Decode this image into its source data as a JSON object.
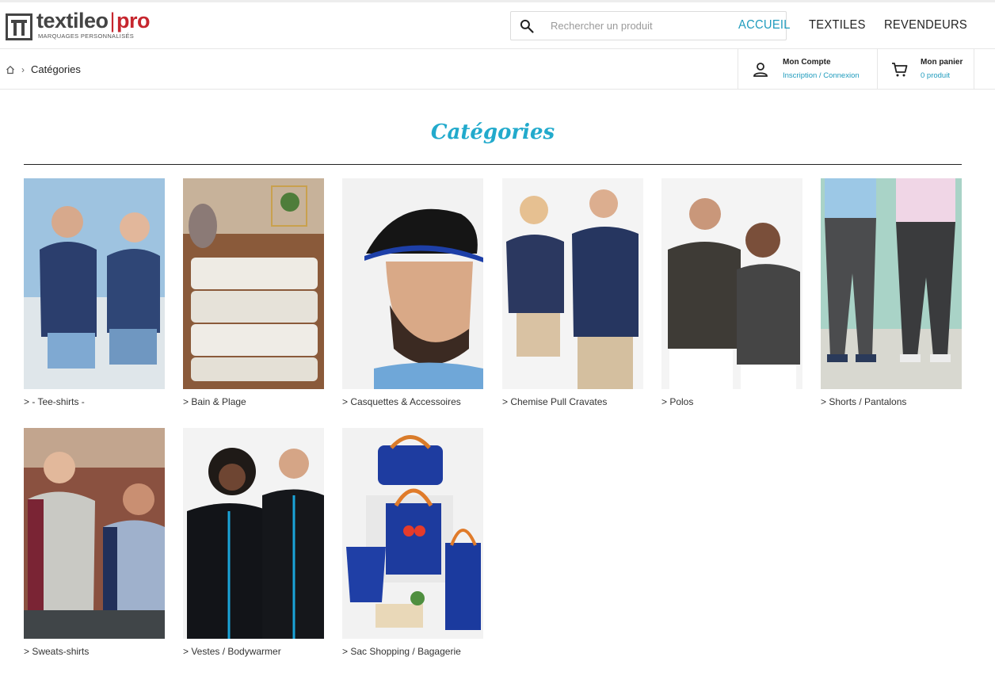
{
  "logo": {
    "name": "textileo",
    "divider": "|",
    "suffix": "pro",
    "tagline": "MARQUAGES PERSONNALISÉS"
  },
  "search": {
    "placeholder": "Rechercher un produit",
    "value": ""
  },
  "nav": {
    "items": [
      "ACCUEIL",
      "TEXTILES",
      "REVENDEURS"
    ],
    "active": "ACCUEIL"
  },
  "breadcrumb": {
    "separator": "›",
    "current": "Catégories"
  },
  "account": {
    "title": "Mon Compte",
    "link": "Inscription / Connexion"
  },
  "cart": {
    "title": "Mon panier",
    "count": "0 produit"
  },
  "page": {
    "title": "Catégories"
  },
  "categories": [
    {
      "label": "> - Tee-shirts -"
    },
    {
      "label": "> Bain & Plage"
    },
    {
      "label": "> Casquettes & Accessoires"
    },
    {
      "label": "> Chemise Pull Cravates"
    },
    {
      "label": "> Polos"
    },
    {
      "label": "> Shorts / Pantalons"
    },
    {
      "label": "> Sweats-shirts"
    },
    {
      "label": "> Vestes / Bodywarmer"
    },
    {
      "label": "> Sac Shopping / Bagagerie"
    }
  ],
  "colors": {
    "accent": "#1f9bbd",
    "title": "#22aacc",
    "brand_red": "#c6262e"
  },
  "icons": [
    "logo-mark-icon",
    "search-icon",
    "home-icon",
    "user-icon",
    "cart-icon"
  ]
}
